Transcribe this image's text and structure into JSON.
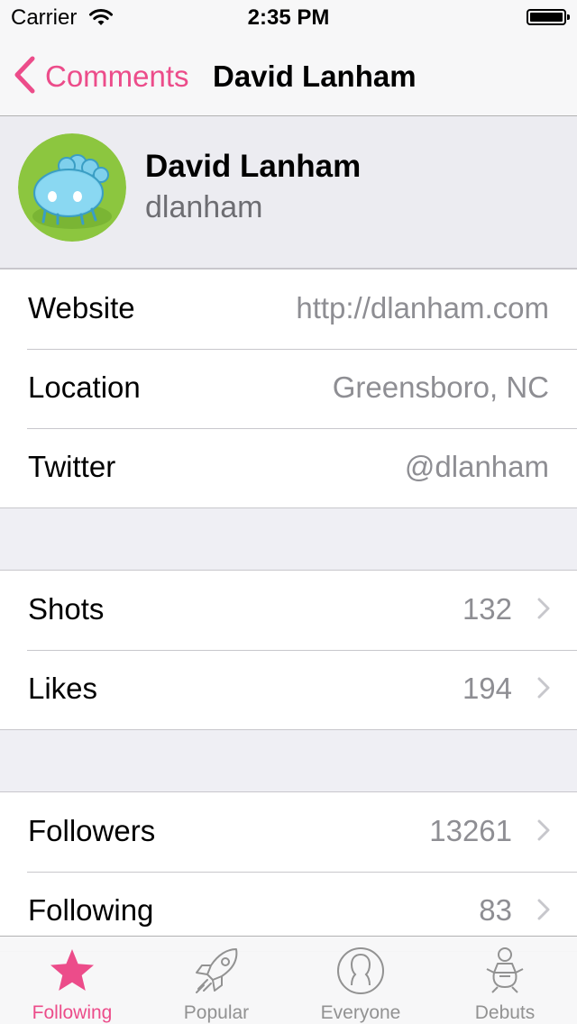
{
  "status_bar": {
    "carrier": "Carrier",
    "time": "2:35 PM"
  },
  "nav": {
    "back_label": "Comments",
    "title": "David Lanham"
  },
  "profile": {
    "name": "David Lanham",
    "username": "dlanham"
  },
  "info_rows": [
    {
      "label": "Website",
      "value": "http://dlanham.com"
    },
    {
      "label": "Location",
      "value": "Greensboro, NC"
    },
    {
      "label": "Twitter",
      "value": "@dlanham"
    }
  ],
  "shot_rows": [
    {
      "label": "Shots",
      "value": "132"
    },
    {
      "label": "Likes",
      "value": "194"
    }
  ],
  "social_rows": [
    {
      "label": "Followers",
      "value": "13261"
    },
    {
      "label": "Following",
      "value": "83"
    }
  ],
  "tabs": [
    {
      "label": "Following",
      "icon": "star-icon",
      "active": true
    },
    {
      "label": "Popular",
      "icon": "rocket-icon",
      "active": false
    },
    {
      "label": "Everyone",
      "icon": "person-circle-icon",
      "active": false
    },
    {
      "label": "Debuts",
      "icon": "baby-icon",
      "active": false
    }
  ],
  "colors": {
    "accent": "#ec4c8a",
    "background": "#efeff4",
    "secondary_text": "#8e8e93"
  }
}
